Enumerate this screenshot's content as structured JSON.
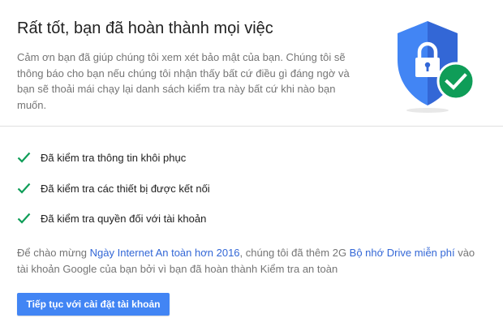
{
  "header": {
    "title": "Rất tốt, bạn đã hoàn thành mọi việc",
    "intro": "Cảm ơn bạn đã giúp chúng tôi xem xét bảo mật của bạn. Chúng tôi sẽ thông báo cho bạn nếu chúng tôi nhận thấy bất cứ điều gì đáng ngờ và bạn sẽ thoải mái chạy lại danh sách kiểm tra này bất cứ khi nào bạn muốn."
  },
  "illustration": {
    "shield_icon": "shield-lock-icon",
    "badge_icon": "check-circle-icon",
    "shield_color": "#4285f4",
    "shield_dark_color": "#3367d6",
    "badge_color": "#0f9d58"
  },
  "checklist": {
    "check_color": "#0f9d58",
    "items": [
      {
        "label": "Đã kiểm tra thông tin khôi phục"
      },
      {
        "label": "Đã kiểm tra các thiết bị được kết nối"
      },
      {
        "label": "Đã kiểm tra quyền đối với tài khoản"
      }
    ]
  },
  "promo": {
    "text_before": "Để chào mừng ",
    "link1": "Ngày Internet An toàn hơn 2016",
    "text_middle": ", chúng tôi đã thêm 2G ",
    "link2": "Bộ nhớ Drive miễn phí",
    "text_after": " vào tài khoản Google của bạn bởi vì bạn đã hoàn thành Kiểm tra an toàn"
  },
  "actions": {
    "continue_label": "Tiếp tục với cài đặt tài khoản"
  }
}
